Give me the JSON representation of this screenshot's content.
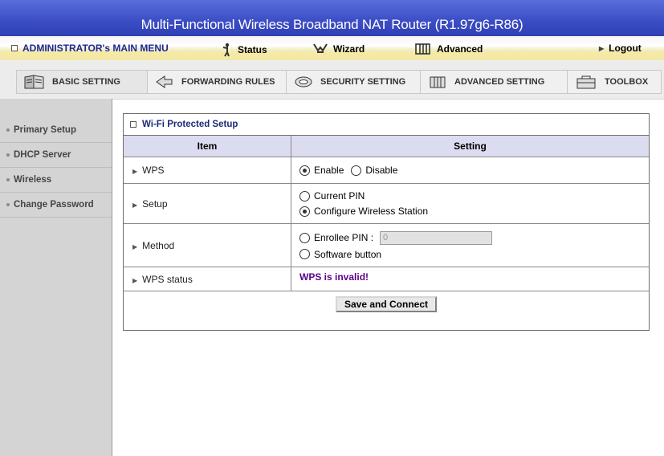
{
  "header": {
    "title": "Multi-Functional Wireless Broadband NAT Router (R1.97g6-R86)"
  },
  "menu": {
    "admin_label": "ADMINISTRATOR's MAIN MENU",
    "status_label": "Status",
    "wizard_label": "Wizard",
    "advanced_label": "Advanced",
    "logout_label": "Logout"
  },
  "tabs": [
    {
      "label": "BASIC SETTING",
      "icon": "book-icon"
    },
    {
      "label": "FORWARDING RULES",
      "icon": "arrows-icon"
    },
    {
      "label": "SECURITY SETTING",
      "icon": "shield-icon"
    },
    {
      "label": "ADVANCED SETTING",
      "icon": "gears-icon"
    },
    {
      "label": "TOOLBOX",
      "icon": "toolbox-icon"
    }
  ],
  "sidebar": {
    "items": [
      {
        "label": "Primary Setup"
      },
      {
        "label": "DHCP Server"
      },
      {
        "label": "Wireless"
      },
      {
        "label": "Change Password"
      }
    ]
  },
  "panel": {
    "title": "Wi-Fi Protected Setup",
    "col_item": "Item",
    "col_setting": "Setting",
    "wps_label": "WPS",
    "wps_enable": "Enable",
    "wps_disable": "Disable",
    "setup_label": "Setup",
    "setup_current_pin": "Current PIN",
    "setup_configure": "Configure Wireless Station",
    "method_label": "Method",
    "method_enrollee": "Enrollee PIN :",
    "method_enrollee_value": "0",
    "method_software": "Software button",
    "wps_status_label": "WPS status",
    "wps_status_value": "WPS is invalid!",
    "save_button": "Save and Connect"
  },
  "colors": {
    "title_bar": "#3d4fc6",
    "status_text": "#5b0088",
    "header_row": "#dbdcf0"
  }
}
